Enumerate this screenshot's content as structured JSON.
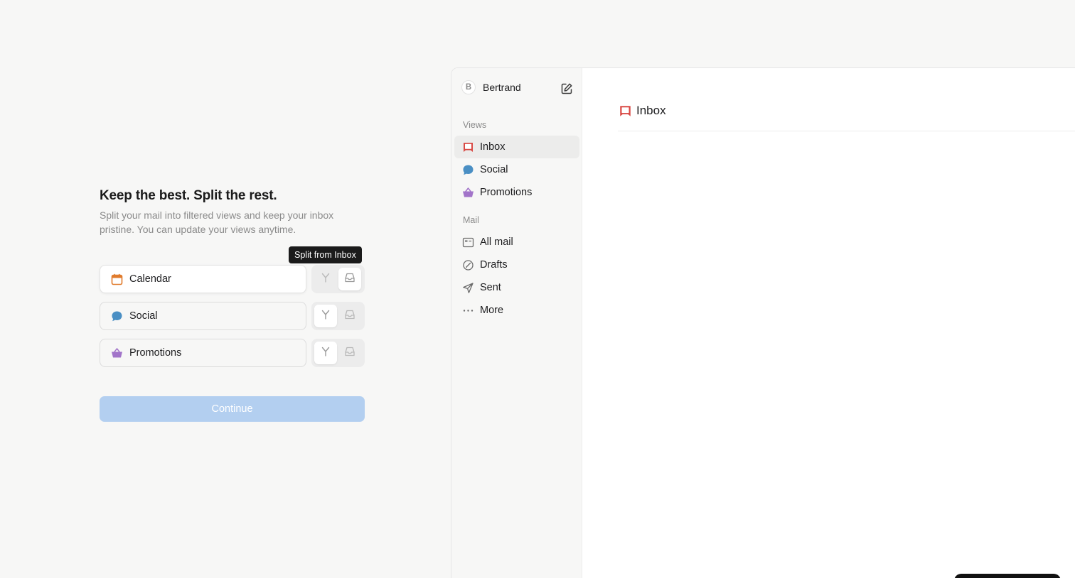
{
  "onboarding": {
    "title": "Keep the best. Split the rest.",
    "subtitle": "Split your mail into filtered views and keep your inbox pristine. You can update your views anytime.",
    "rows": [
      {
        "label": "Calendar",
        "icon": "calendar-icon",
        "color": "#e07b2c",
        "selected": "inbox"
      },
      {
        "label": "Social",
        "icon": "chat-bubble-icon",
        "color": "#4a8fc4",
        "selected": "split"
      },
      {
        "label": "Promotions",
        "icon": "basket-icon",
        "color": "#a274c9",
        "selected": "split"
      }
    ],
    "tooltip": "Split from Inbox",
    "continue_label": "Continue"
  },
  "app": {
    "user": {
      "initial": "B",
      "name": "Bertrand"
    },
    "views_label": "Views",
    "views": [
      {
        "label": "Inbox",
        "icon": "inbox-icon",
        "color": "#d94a45",
        "active": true
      },
      {
        "label": "Social",
        "icon": "chat-bubble-icon",
        "color": "#4a8fc4"
      },
      {
        "label": "Promotions",
        "icon": "basket-icon",
        "color": "#a274c9"
      }
    ],
    "mail_label": "Mail",
    "mail": [
      {
        "label": "All mail",
        "icon": "all-mail-icon"
      },
      {
        "label": "Drafts",
        "icon": "drafts-icon"
      },
      {
        "label": "Sent",
        "icon": "send-icon"
      },
      {
        "label": "More",
        "icon": "more-icon"
      }
    ],
    "main_title": "Inbox"
  },
  "colors": {
    "accent_disabled": "#b3cff0",
    "inbox_red": "#d94a45",
    "social_blue": "#4a8fc4",
    "promo_purple": "#a274c9",
    "calendar_orange": "#e07b2c"
  }
}
